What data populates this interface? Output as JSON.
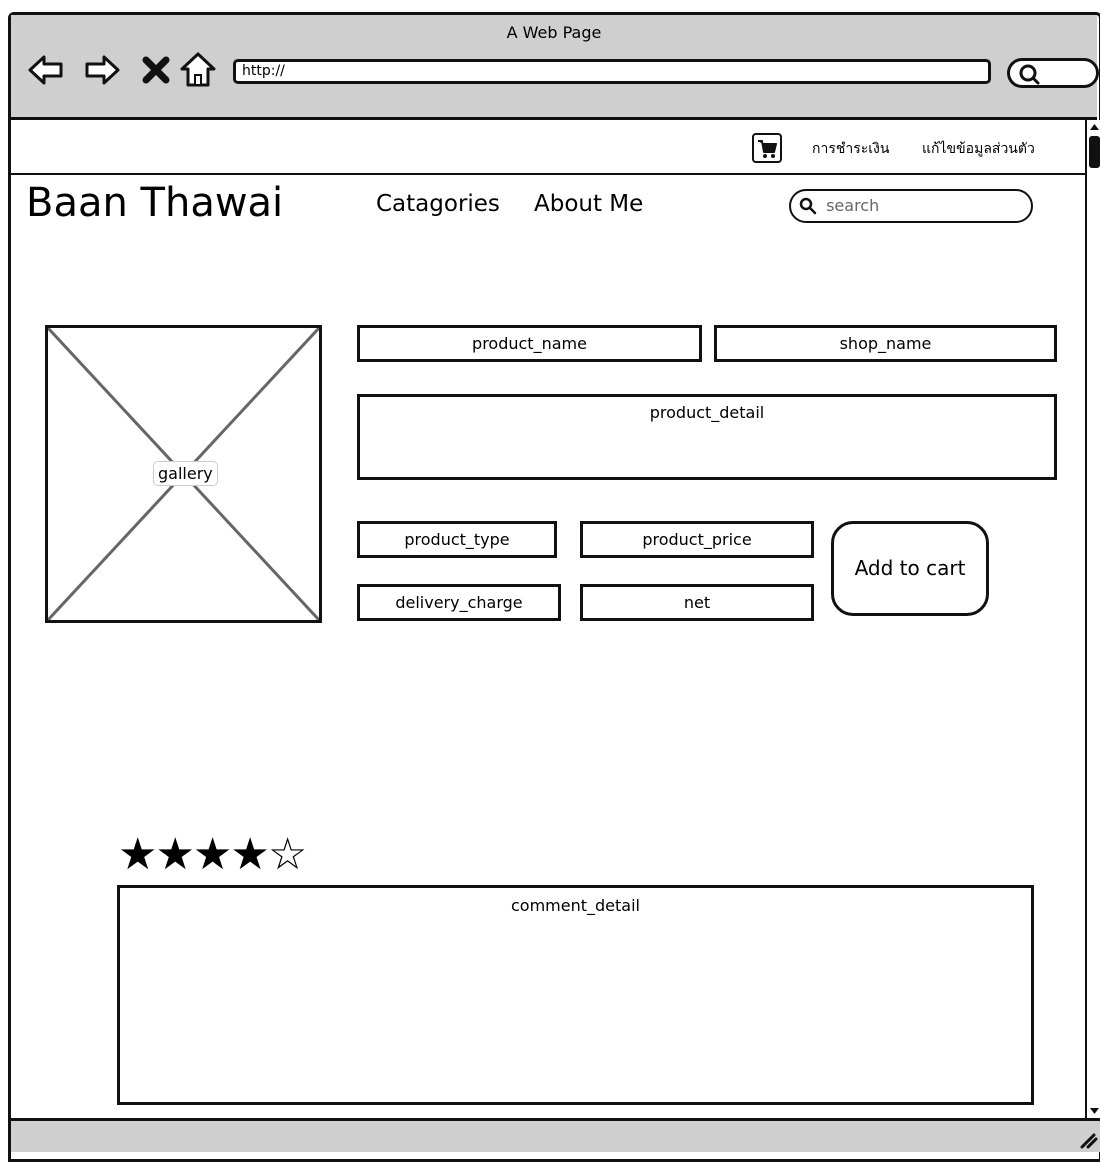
{
  "window": {
    "title": "A Web Page"
  },
  "browser": {
    "url": "http://",
    "back_icon": "arrow-left-icon",
    "forward_icon": "arrow-right-icon",
    "stop_icon": "close-icon",
    "home_icon": "home-icon",
    "search_icon": "search-icon"
  },
  "topbar": {
    "cart_icon": "cart-icon",
    "links": [
      "การชำระเงิน",
      "แก้ไขข้อมูลส่วนตัว"
    ]
  },
  "header": {
    "brand": "Baan Thawai",
    "menu": [
      "Catagories",
      "About Me"
    ],
    "search_placeholder": "search"
  },
  "product": {
    "gallery_label": "gallery",
    "product_name": "product_name",
    "shop_name": "shop_name",
    "product_detail": "product_detail",
    "product_type": "product_type",
    "product_price": "product_price",
    "delivery_charge": "delivery_charge",
    "net": "net",
    "add_to_cart": "Add to cart"
  },
  "review": {
    "rating": 4,
    "max_rating": 5,
    "comment_detail": "comment_detail"
  }
}
